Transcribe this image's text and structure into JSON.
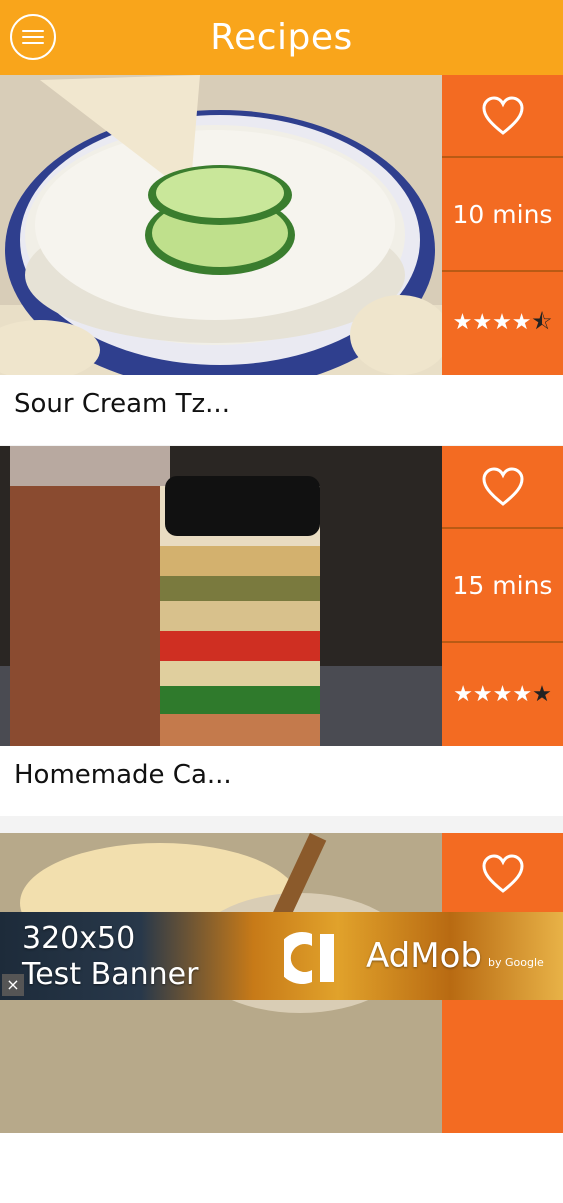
{
  "header": {
    "title": "Recipes"
  },
  "recipes": [
    {
      "name": "Sour Cream Tz...",
      "time": "10 mins",
      "rating": 4.5,
      "stars_text": "★★★★",
      "half": "⯪",
      "dim": ""
    },
    {
      "name": "Homemade Ca...",
      "time": "15 mins",
      "rating": 4,
      "stars_text": "★★★★",
      "half": "",
      "dim": "★"
    },
    {
      "name": "",
      "time": "",
      "rating": null
    }
  ],
  "ad": {
    "line1": "320x50",
    "line2": "Test Banner",
    "brand": "AdMob",
    "byline": "by Google",
    "close": "×"
  },
  "colors": {
    "header": "#f9a51b",
    "side_panel": "#f36b22"
  }
}
